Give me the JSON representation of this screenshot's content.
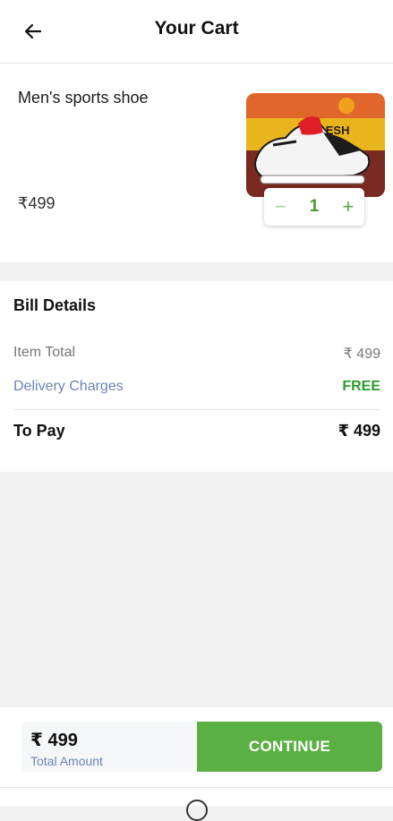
{
  "header": {
    "title": "Your Cart",
    "back_icon": "arrow-left-icon"
  },
  "cart": {
    "items": [
      {
        "name": "Men's sports shoe",
        "price": "₹499",
        "quantity": "1",
        "image_brand_text": "SOLESH",
        "image_icon": "sports-shoe-image"
      }
    ],
    "decrement_symbol": "−",
    "increment_symbol": "+"
  },
  "bill": {
    "title": "Bill Details",
    "item_total_label": "Item Total",
    "item_total_value": "₹ 499",
    "delivery_label": "Delivery Charges",
    "delivery_value": "FREE",
    "to_pay_label": "To Pay",
    "to_pay_value": "₹ 499"
  },
  "footer": {
    "total_amount": "₹ 499",
    "total_label": "Total Amount",
    "continue_label": "CONTINUE"
  },
  "colors": {
    "accent_green": "#5bb043",
    "free_green": "#2e9b2e",
    "link_blue": "#6b83b6",
    "background": "#f2f2f2"
  }
}
